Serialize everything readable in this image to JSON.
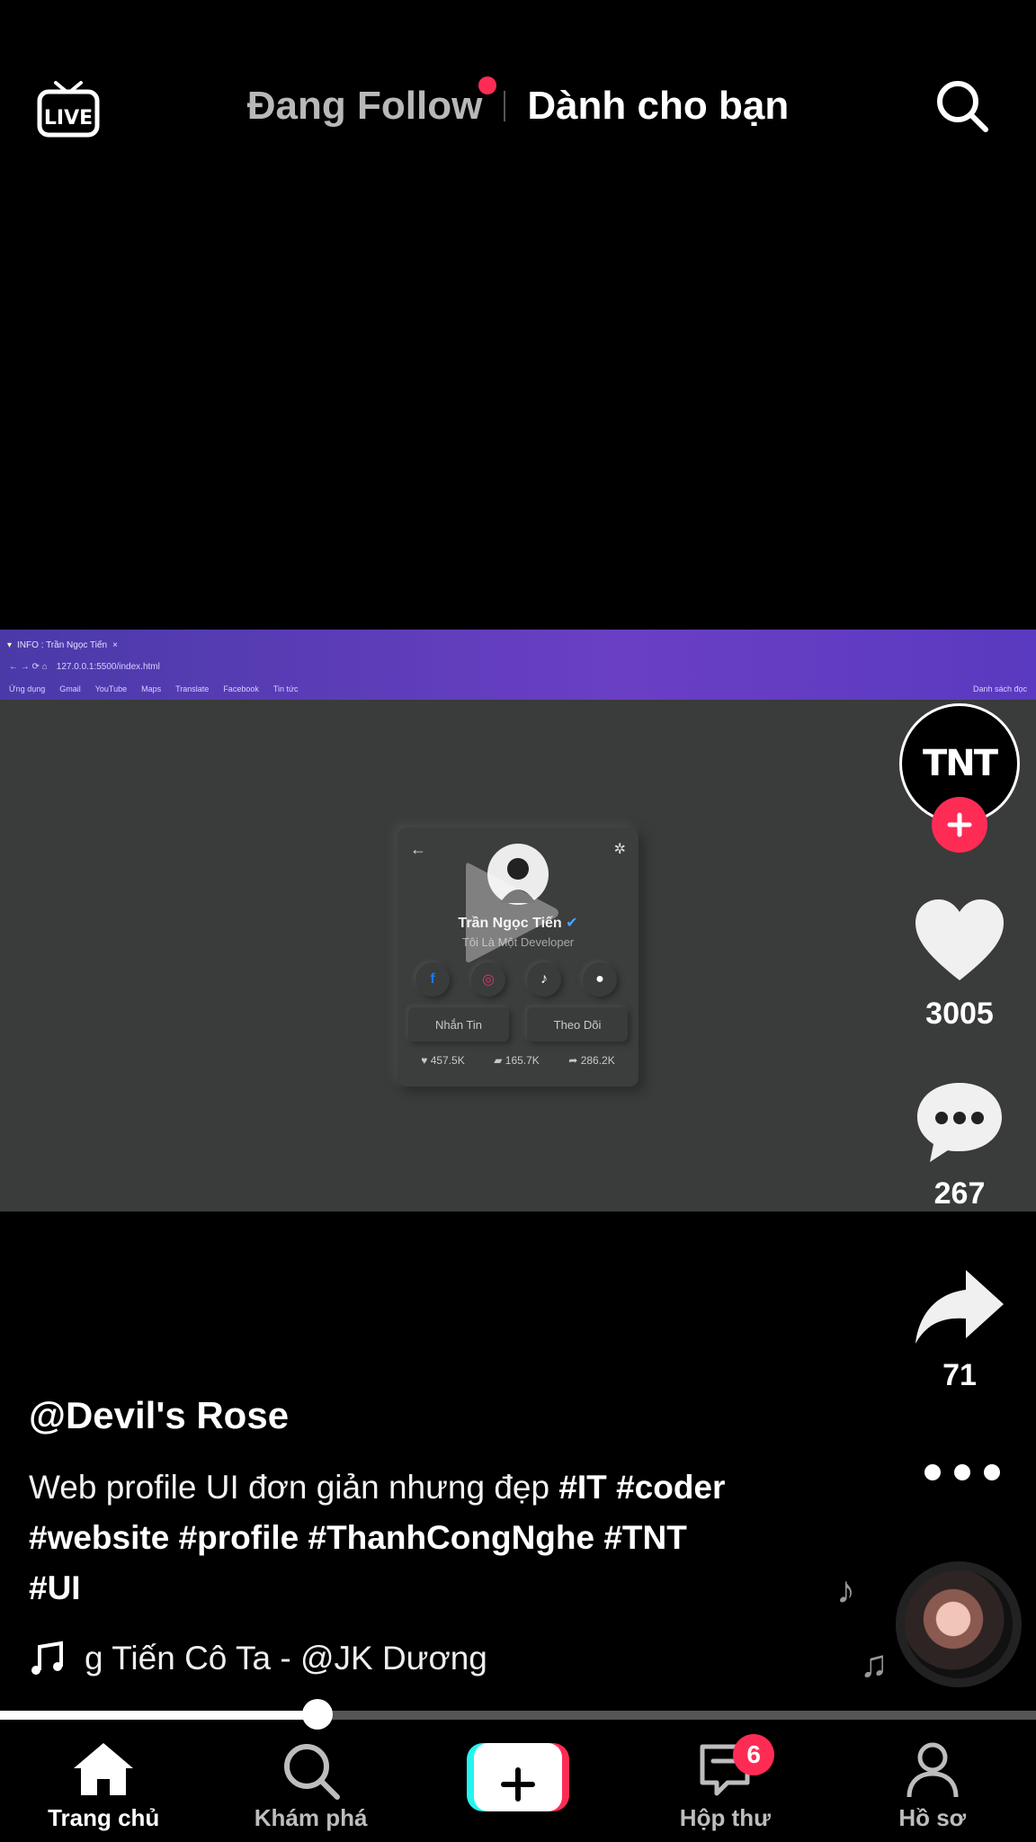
{
  "top_bar": {
    "tab_following": "Đang Follow",
    "tab_for_you": "Dành cho bạn"
  },
  "video": {
    "browser_tab": "INFO : Trần Ngọc Tiến",
    "browser_url": "127.0.0.1:5500/index.html",
    "bookmarks": [
      "Ứng dụng",
      "Gmail",
      "YouTube",
      "Maps",
      "Translate",
      "Facebook",
      "Tin tức"
    ],
    "bookmarks_right": "Danh sách đọc",
    "card_name": "Trần Ngọc Tiến",
    "card_subtitle": "Tôi Là Một Developer",
    "card_btn_message": "Nhắn Tin",
    "card_btn_follow": "Theo Dõi",
    "card_likes": "457.5K",
    "card_comments": "165.7K",
    "card_shares": "286.2K"
  },
  "creator": {
    "avatar_text": "TNT",
    "username": "@Devil's Rose"
  },
  "actions": {
    "likes": "3005",
    "comments": "267",
    "shares": "71"
  },
  "caption": {
    "text": "Web profile UI đơn giản nhưng đẹp ",
    "hashtags_line1": "#IT #coder",
    "hashtags_line2": "#website #profile #ThanhCongNghe #TNT",
    "hashtags_line3": "#UI"
  },
  "music": {
    "text": "g Tiến     Cô Ta - @JK Dương"
  },
  "playback": {
    "progress": 0.306
  },
  "nav": {
    "home": "Trang chủ",
    "discover": "Khám phá",
    "inbox": "Hộp thư",
    "inbox_badge": "6",
    "profile": "Hồ sơ"
  },
  "colors": {
    "accent": "#fe2c55",
    "cyan": "#25f4ee"
  }
}
